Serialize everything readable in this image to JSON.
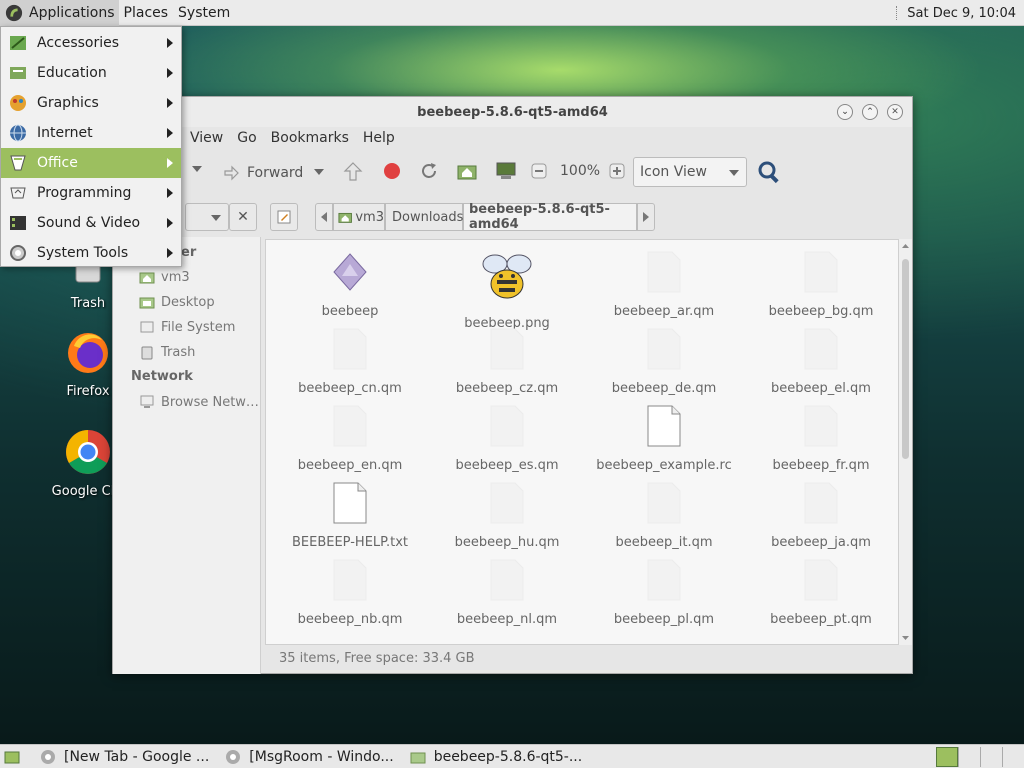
{
  "top_panel": {
    "menus": [
      "Applications",
      "Places",
      "System"
    ],
    "clock": "Sat Dec 9, 10:04"
  },
  "desktop_icons": [
    {
      "label": "Trash",
      "icon": "trash-icon"
    },
    {
      "label": "Firefox",
      "icon": "firefox-icon"
    },
    {
      "label": "Google Chr",
      "icon": "chrome-icon"
    }
  ],
  "apps_menu": {
    "items": [
      {
        "label": "Accessories",
        "icon": "accessories-icon"
      },
      {
        "label": "Education",
        "icon": "education-icon"
      },
      {
        "label": "Graphics",
        "icon": "graphics-icon"
      },
      {
        "label": "Internet",
        "icon": "internet-icon"
      },
      {
        "label": "Office",
        "icon": "office-icon",
        "active": true
      },
      {
        "label": "Programming",
        "icon": "programming-icon"
      },
      {
        "label": "Sound & Video",
        "icon": "sound-video-icon"
      },
      {
        "label": "System Tools",
        "icon": "system-tools-icon"
      }
    ]
  },
  "file_manager": {
    "title": "beebeep-5.8.6-qt5-amd64",
    "menubar": [
      "View",
      "Go",
      "Bookmarks",
      "Help"
    ],
    "toolbar": {
      "forward": "Forward",
      "zoom": "100%",
      "view_mode": "Icon View"
    },
    "breadcrumbs": [
      "vm3",
      "Downloads",
      "beebeep-5.8.6-qt5-amd64"
    ],
    "sidebar": {
      "computer_heading_fragment": "er",
      "places": [
        "vm3",
        "Desktop",
        "File System",
        "Trash"
      ],
      "network_heading": "Network",
      "network_items": [
        "Browse Netw…"
      ]
    },
    "files": [
      "beebeep",
      "beebeep.png",
      "beebeep_ar.qm",
      "beebeep_bg.qm",
      "beebeep_cn.qm",
      "beebeep_cz.qm",
      "beebeep_de.qm",
      "beebeep_el.qm",
      "beebeep_en.qm",
      "beebeep_es.qm",
      "beebeep_example.rc",
      "beebeep_fr.qm",
      "BEEBEEP-HELP.txt",
      "beebeep_hu.qm",
      "beebeep_it.qm",
      "beebeep_ja.qm",
      "beebeep_nb.qm",
      "beebeep_nl.qm",
      "beebeep_pl.qm",
      "beebeep_pt.qm"
    ],
    "status": "35 items, Free space: 33.4 GB"
  },
  "taskbar": {
    "tasks": [
      "[New Tab - Google ...",
      "[MsgRoom - Windo...",
      "beebeep-5.8.6-qt5-..."
    ]
  }
}
